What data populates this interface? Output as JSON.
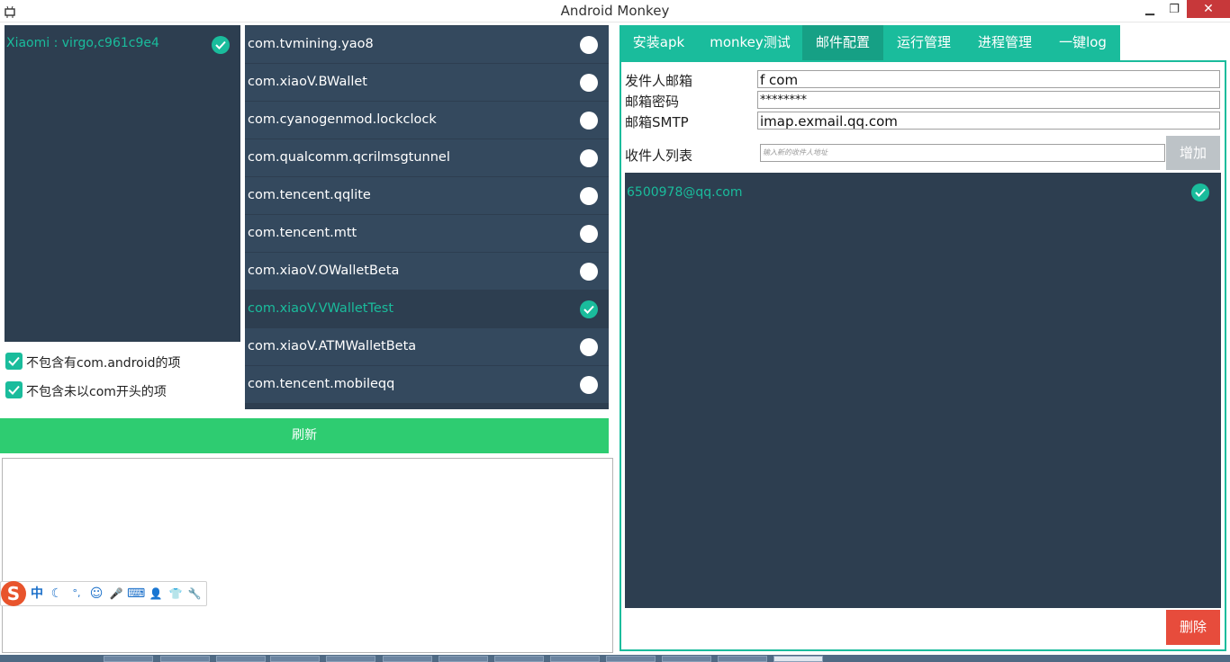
{
  "window": {
    "title": "Android Monkey",
    "minimize_glyph": "▁",
    "restore_glyph": "❐",
    "close_glyph": "✕"
  },
  "device_list": {
    "items": [
      {
        "label": "Xiaomi : virgo,c961c9e4",
        "checked": true
      }
    ]
  },
  "filters": {
    "exclude_android": "不包含有com.android的项",
    "exclude_non_com": "不包含未以com开头的项"
  },
  "packages": [
    {
      "label": "com.tvmining.yao8",
      "selected": false
    },
    {
      "label": "com.xiaoV.BWallet",
      "selected": false
    },
    {
      "label": "com.cyanogenmod.lockclock",
      "selected": false
    },
    {
      "label": "com.qualcomm.qcrilmsgtunnel",
      "selected": false
    },
    {
      "label": "com.tencent.qqlite",
      "selected": false
    },
    {
      "label": "com.tencent.mtt",
      "selected": false
    },
    {
      "label": "com.xiaoV.OWalletBeta",
      "selected": false
    },
    {
      "label": "com.xiaoV.VWalletTest",
      "selected": true
    },
    {
      "label": "com.xiaoV.ATMWalletBeta",
      "selected": false
    },
    {
      "label": "com.tencent.mobileqq",
      "selected": false
    }
  ],
  "refresh_label": "刷新",
  "ime": {
    "logo": "S",
    "icons": [
      "中",
      "☾",
      "°,",
      "☺",
      "🎤",
      "⌨",
      "👤",
      "👕",
      "🔧"
    ]
  },
  "tabs": [
    {
      "label": "安装apk",
      "active": false
    },
    {
      "label": "monkey测试",
      "active": false
    },
    {
      "label": "邮件配置",
      "active": true
    },
    {
      "label": "运行管理",
      "active": false
    },
    {
      "label": "进程管理",
      "active": false
    },
    {
      "label": "一键log",
      "active": false
    }
  ],
  "mail_config": {
    "sender_label": "发件人邮箱",
    "sender_value": "f              com",
    "password_label": "邮箱密码",
    "password_value": "********",
    "smtp_label": "邮箱SMTP",
    "smtp_value": "imap.exmail.qq.com",
    "recipients_label": "收件人列表",
    "recipient_placeholder": "输入新的收件人地址",
    "add_label": "增加",
    "delete_label": "删除"
  },
  "recipients": [
    {
      "label": "6500978@qq.com",
      "checked": true
    }
  ],
  "colors": {
    "panel_dark": "#2d3e50",
    "row": "#34495e",
    "accent_teal": "#1abc9c",
    "tab_active": "#16a085",
    "refresh_green": "#2ecc71",
    "delete_red": "#e74c3c",
    "add_gray": "#bdc3c7"
  }
}
